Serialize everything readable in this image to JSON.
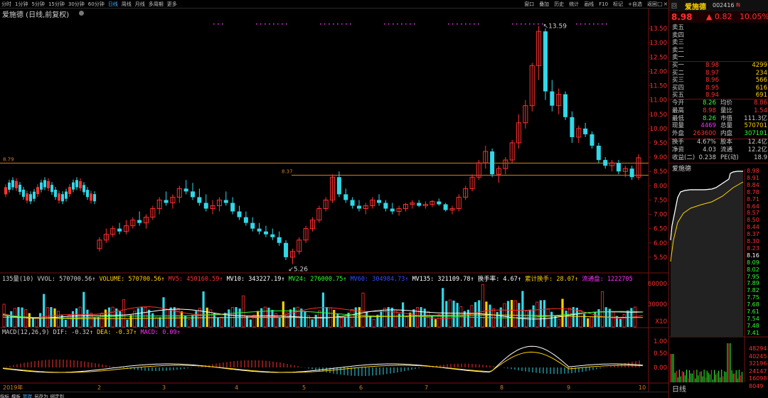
{
  "toolbar": {
    "periods": [
      "分时",
      "1分钟",
      "5分钟",
      "15分钟",
      "30分钟",
      "60分钟",
      "日线",
      "周线",
      "月线",
      "多周期",
      "更多"
    ],
    "active_period": "日线",
    "tools": [
      "窗口",
      "叠加",
      "历史",
      "统计",
      "画线",
      "F10",
      "标记",
      "+自选",
      "返回"
    ],
    "window_buttons": [
      "–",
      "□",
      "×"
    ]
  },
  "chart": {
    "title": "爱施德 (日线,前复权)",
    "ohlc": [
      [
        5.8,
        6.2,
        5.7,
        6.1
      ],
      [
        6.1,
        6.5,
        6.0,
        6.3
      ],
      [
        6.3,
        6.6,
        6.2,
        6.5
      ],
      [
        6.5,
        6.7,
        6.3,
        6.4
      ],
      [
        6.4,
        6.8,
        6.3,
        6.6
      ],
      [
        6.6,
        6.9,
        6.5,
        6.8
      ],
      [
        6.8,
        7.1,
        6.6,
        6.7
      ],
      [
        6.7,
        7.0,
        6.5,
        6.9
      ],
      [
        6.9,
        7.3,
        6.8,
        7.2
      ],
      [
        7.2,
        7.6,
        7.0,
        7.5
      ],
      [
        7.5,
        7.8,
        7.3,
        7.4
      ],
      [
        7.4,
        7.7,
        7.2,
        7.6
      ],
      [
        7.6,
        8.0,
        7.4,
        7.9
      ],
      [
        7.9,
        8.2,
        7.7,
        7.8
      ],
      [
        7.8,
        8.1,
        7.5,
        7.6
      ],
      [
        7.6,
        7.9,
        7.3,
        7.4
      ],
      [
        7.4,
        7.7,
        7.1,
        7.2
      ],
      [
        7.2,
        7.5,
        7.0,
        7.3
      ],
      [
        7.3,
        7.6,
        7.1,
        7.5
      ],
      [
        7.5,
        7.8,
        7.3,
        7.4
      ],
      [
        7.4,
        7.6,
        7.0,
        7.1
      ],
      [
        7.1,
        7.3,
        6.8,
        6.9
      ],
      [
        6.9,
        7.1,
        6.6,
        6.7
      ],
      [
        6.7,
        6.9,
        6.4,
        6.5
      ],
      [
        6.5,
        6.7,
        6.3,
        6.4
      ],
      [
        6.4,
        6.6,
        6.2,
        6.3
      ],
      [
        6.3,
        6.5,
        6.1,
        6.2
      ],
      [
        6.2,
        6.4,
        5.9,
        6.0
      ],
      [
        6.0,
        6.1,
        5.4,
        5.5
      ],
      [
        5.5,
        5.8,
        5.26,
        5.7
      ],
      [
        5.7,
        6.2,
        5.6,
        6.1
      ],
      [
        6.1,
        6.6,
        6.0,
        6.5
      ],
      [
        6.5,
        6.9,
        6.4,
        6.8
      ],
      [
        6.8,
        7.3,
        6.7,
        7.2
      ],
      [
        7.2,
        7.6,
        7.1,
        7.5
      ],
      [
        7.5,
        8.4,
        7.4,
        8.3
      ],
      [
        8.3,
        8.5,
        7.6,
        7.7
      ],
      [
        7.7,
        7.9,
        7.4,
        7.5
      ],
      [
        7.5,
        7.6,
        7.2,
        7.3
      ],
      [
        7.3,
        7.5,
        7.1,
        7.2
      ],
      [
        7.2,
        7.4,
        7.0,
        7.3
      ],
      [
        7.3,
        7.6,
        7.2,
        7.5
      ],
      [
        7.5,
        7.7,
        7.3,
        7.4
      ],
      [
        7.4,
        7.5,
        7.1,
        7.2
      ],
      [
        7.2,
        7.4,
        7.0,
        7.1
      ],
      [
        7.1,
        7.3,
        6.95,
        7.2
      ],
      [
        7.2,
        7.4,
        7.1,
        7.35
      ],
      [
        7.35,
        7.5,
        7.2,
        7.4
      ],
      [
        7.4,
        7.5,
        7.25,
        7.3
      ],
      [
        7.3,
        7.45,
        7.2,
        7.35
      ],
      [
        7.35,
        7.5,
        7.25,
        7.45
      ],
      [
        7.45,
        7.55,
        7.3,
        7.35
      ],
      [
        7.35,
        7.4,
        7.1,
        7.15
      ],
      [
        7.15,
        7.3,
        7.0,
        7.2
      ],
      [
        7.2,
        7.7,
        7.1,
        7.6
      ],
      [
        7.6,
        8.0,
        7.5,
        7.9
      ],
      [
        7.9,
        8.4,
        7.8,
        8.3
      ],
      [
        8.3,
        8.9,
        8.2,
        8.8
      ],
      [
        8.8,
        9.4,
        8.6,
        9.2
      ],
      [
        9.2,
        9.3,
        8.3,
        8.4
      ],
      [
        8.4,
        8.7,
        8.1,
        8.6
      ],
      [
        8.6,
        9.0,
        8.4,
        8.9
      ],
      [
        8.9,
        9.6,
        8.8,
        9.5
      ],
      [
        9.5,
        10.5,
        9.3,
        10.2
      ],
      [
        10.2,
        11.0,
        10.0,
        10.8
      ],
      [
        10.8,
        12.3,
        10.6,
        12.2
      ],
      [
        12.2,
        13.59,
        11.7,
        13.4
      ],
      [
        13.4,
        13.5,
        11.0,
        11.3
      ],
      [
        11.3,
        11.7,
        10.6,
        10.8
      ],
      [
        10.8,
        11.4,
        10.5,
        11.2
      ],
      [
        11.2,
        11.3,
        10.3,
        10.4
      ],
      [
        10.4,
        10.6,
        9.5,
        9.7
      ],
      [
        9.7,
        10.1,
        9.5,
        10.0
      ],
      [
        10.0,
        10.2,
        9.7,
        9.8
      ],
      [
        9.8,
        9.9,
        9.3,
        9.4
      ],
      [
        9.4,
        9.5,
        8.8,
        8.9
      ],
      [
        8.9,
        9.0,
        8.6,
        8.7
      ],
      [
        8.7,
        8.9,
        8.5,
        8.8
      ],
      [
        8.8,
        8.9,
        8.4,
        8.5
      ],
      [
        8.5,
        8.7,
        8.3,
        8.6
      ],
      [
        8.6,
        8.7,
        8.2,
        8.3
      ],
      [
        8.3,
        9.1,
        8.2,
        8.98
      ]
    ],
    "price_min": 5.0,
    "price_max": 13.9,
    "ref_line_high": 8.79,
    "ref_line_low": 8.37,
    "label_high": "8.79",
    "label_low": "8.37",
    "peak_label": "13.59",
    "trough_label": "5.26",
    "axis_ticks": [
      "13.50",
      "13.00",
      "12.50",
      "12.00",
      "11.50",
      "11.00",
      "10.50",
      "10.00",
      "9.50",
      "9.00",
      "8.50",
      "8.00",
      "7.50",
      "7.00",
      "6.50",
      "6.00",
      "5.50"
    ],
    "date_labels": [
      "2019年",
      "2",
      "3",
      "4",
      "5",
      "6",
      "7",
      "8",
      "9",
      "10"
    ]
  },
  "volume_header": [
    {
      "text": "135量(10) VVOL: 570700.56↑ ",
      "color": "#d0d0d0"
    },
    {
      "text": "VOLUME: 570700.56↑ ",
      "color": "#ffd000"
    },
    {
      "text": "MV5: 450160.59↑ ",
      "color": "#ff3030"
    },
    {
      "text": "MV10: 343227.19↑ ",
      "color": "#ffffff"
    },
    {
      "text": "MV24: 276000.75↑ ",
      "color": "#30ff30"
    },
    {
      "text": "MV60: 304984.73↑ ",
      "color": "#3050ff"
    },
    {
      "text": "MV135: 321109.78↑ ",
      "color": "#ffffff"
    },
    {
      "text": "换手率: 4.67↑ ",
      "color": "#ffffff"
    },
    {
      "text": "累计换手: 28.07↑ ",
      "color": "#ffd000"
    },
    {
      "text": "流通盘: 1222705",
      "color": "#ff30ff"
    }
  ],
  "volume_axis": [
    "60000",
    "30000",
    "X10"
  ],
  "macd_header": [
    {
      "text": "MACD(12,26,9) DIF: -0.32↑ ",
      "color": "#d0d0d0"
    },
    {
      "text": "DEA: -0.37↑ ",
      "color": "#ffd000"
    },
    {
      "text": "MACD: 0.09↑",
      "color": "#ff30ff"
    }
  ],
  "macd_axis": [
    "1.00",
    "0.50",
    "0.00"
  ],
  "bottom_bar": [
    "指标",
    "模板",
    "管理",
    "另存为",
    "绑定到"
  ],
  "right_panel": {
    "header_left": "回",
    "stock_name": "爱施德",
    "code": "002416",
    "code_badge": "融",
    "price": "8.98",
    "change_arrow": "▲",
    "change": "0.82",
    "pct": "10.05%",
    "sell_labels": [
      "卖五",
      "卖四",
      "卖三",
      "卖二",
      "卖一"
    ],
    "buy": [
      {
        "label": "买一",
        "price": "8.98",
        "vol": "4299"
      },
      {
        "label": "买二",
        "price": "8.97",
        "vol": "234"
      },
      {
        "label": "买三",
        "price": "8.96",
        "vol": "566"
      },
      {
        "label": "买四",
        "price": "8.95",
        "vol": "616"
      },
      {
        "label": "买五",
        "price": "8.94",
        "vol": "691"
      }
    ],
    "stats": [
      [
        {
          "t": "今开",
          "c": "#c8c8c8"
        },
        {
          "t": "8.26",
          "c": "#30ff30",
          "r": true
        },
        {
          "t": "均价",
          "c": "#c8c8c8"
        },
        {
          "t": "8.86",
          "c": "#ff3030",
          "r": true
        }
      ],
      [
        {
          "t": "最高",
          "c": "#c8c8c8"
        },
        {
          "t": "8.98",
          "c": "#ff3030",
          "r": true
        },
        {
          "t": "量比",
          "c": "#c8c8c8"
        },
        {
          "t": "1.54",
          "c": "#ff3030",
          "r": true
        }
      ],
      [
        {
          "t": "最低",
          "c": "#c8c8c8"
        },
        {
          "t": "8.26",
          "c": "#30ff30",
          "r": true
        },
        {
          "t": "市值",
          "c": "#c8c8c8"
        },
        {
          "t": "111.3亿",
          "c": "#c8c8c8",
          "r": true
        }
      ],
      [
        {
          "t": "现量",
          "c": "#c8c8c8"
        },
        {
          "t": "4469",
          "c": "#ff30ff",
          "r": true
        },
        {
          "t": "总量",
          "c": "#c8c8c8"
        },
        {
          "t": "570701",
          "c": "#ffd000",
          "r": true
        }
      ],
      [
        {
          "t": "外盘",
          "c": "#c8c8c8"
        },
        {
          "t": "263600",
          "c": "#ff3030",
          "r": true
        },
        {
          "t": "内盘",
          "c": "#c8c8c8"
        },
        {
          "t": "307101",
          "c": "#30ff30",
          "r": true
        }
      ]
    ],
    "stats2": [
      [
        {
          "t": "换手",
          "c": "#c8c8c8"
        },
        {
          "t": "4.67%",
          "c": "#c8c8c8",
          "r": true
        },
        {
          "t": "股本",
          "c": "#c8c8c8"
        },
        {
          "t": "12.4亿",
          "c": "#c8c8c8",
          "r": true
        }
      ],
      [
        {
          "t": "净资",
          "c": "#c8c8c8"
        },
        {
          "t": "4.03",
          "c": "#c8c8c8",
          "r": true
        },
        {
          "t": "流通",
          "c": "#c8c8c8"
        },
        {
          "t": "12.2亿",
          "c": "#c8c8c8",
          "r": true
        }
      ],
      [
        {
          "t": "收益(二)",
          "c": "#c8c8c8"
        },
        {
          "t": "0.238",
          "c": "#c8c8c8",
          "r": true
        },
        {
          "t": "PE(动)",
          "c": "#c8c8c8"
        },
        {
          "t": "18.9",
          "c": "#c8c8c8",
          "r": true
        }
      ]
    ],
    "mini_title": "爱施德",
    "mini_axis": [
      "8.98",
      "8.91",
      "8.84",
      "8.78",
      "8.71",
      "8.64",
      "8.57",
      "8.50",
      "8.44",
      "8.37",
      "8.30",
      "8.23",
      "8.16",
      "8.09",
      "8.02",
      "7.95",
      "7.89",
      "7.82",
      "7.75",
      "7.68",
      "7.61",
      "7.54",
      "7.48",
      "7.41"
    ],
    "vol_axis": [
      "48294",
      "40245",
      "32196",
      "24147",
      "16098",
      "8049"
    ],
    "daily_label": "日线"
  }
}
